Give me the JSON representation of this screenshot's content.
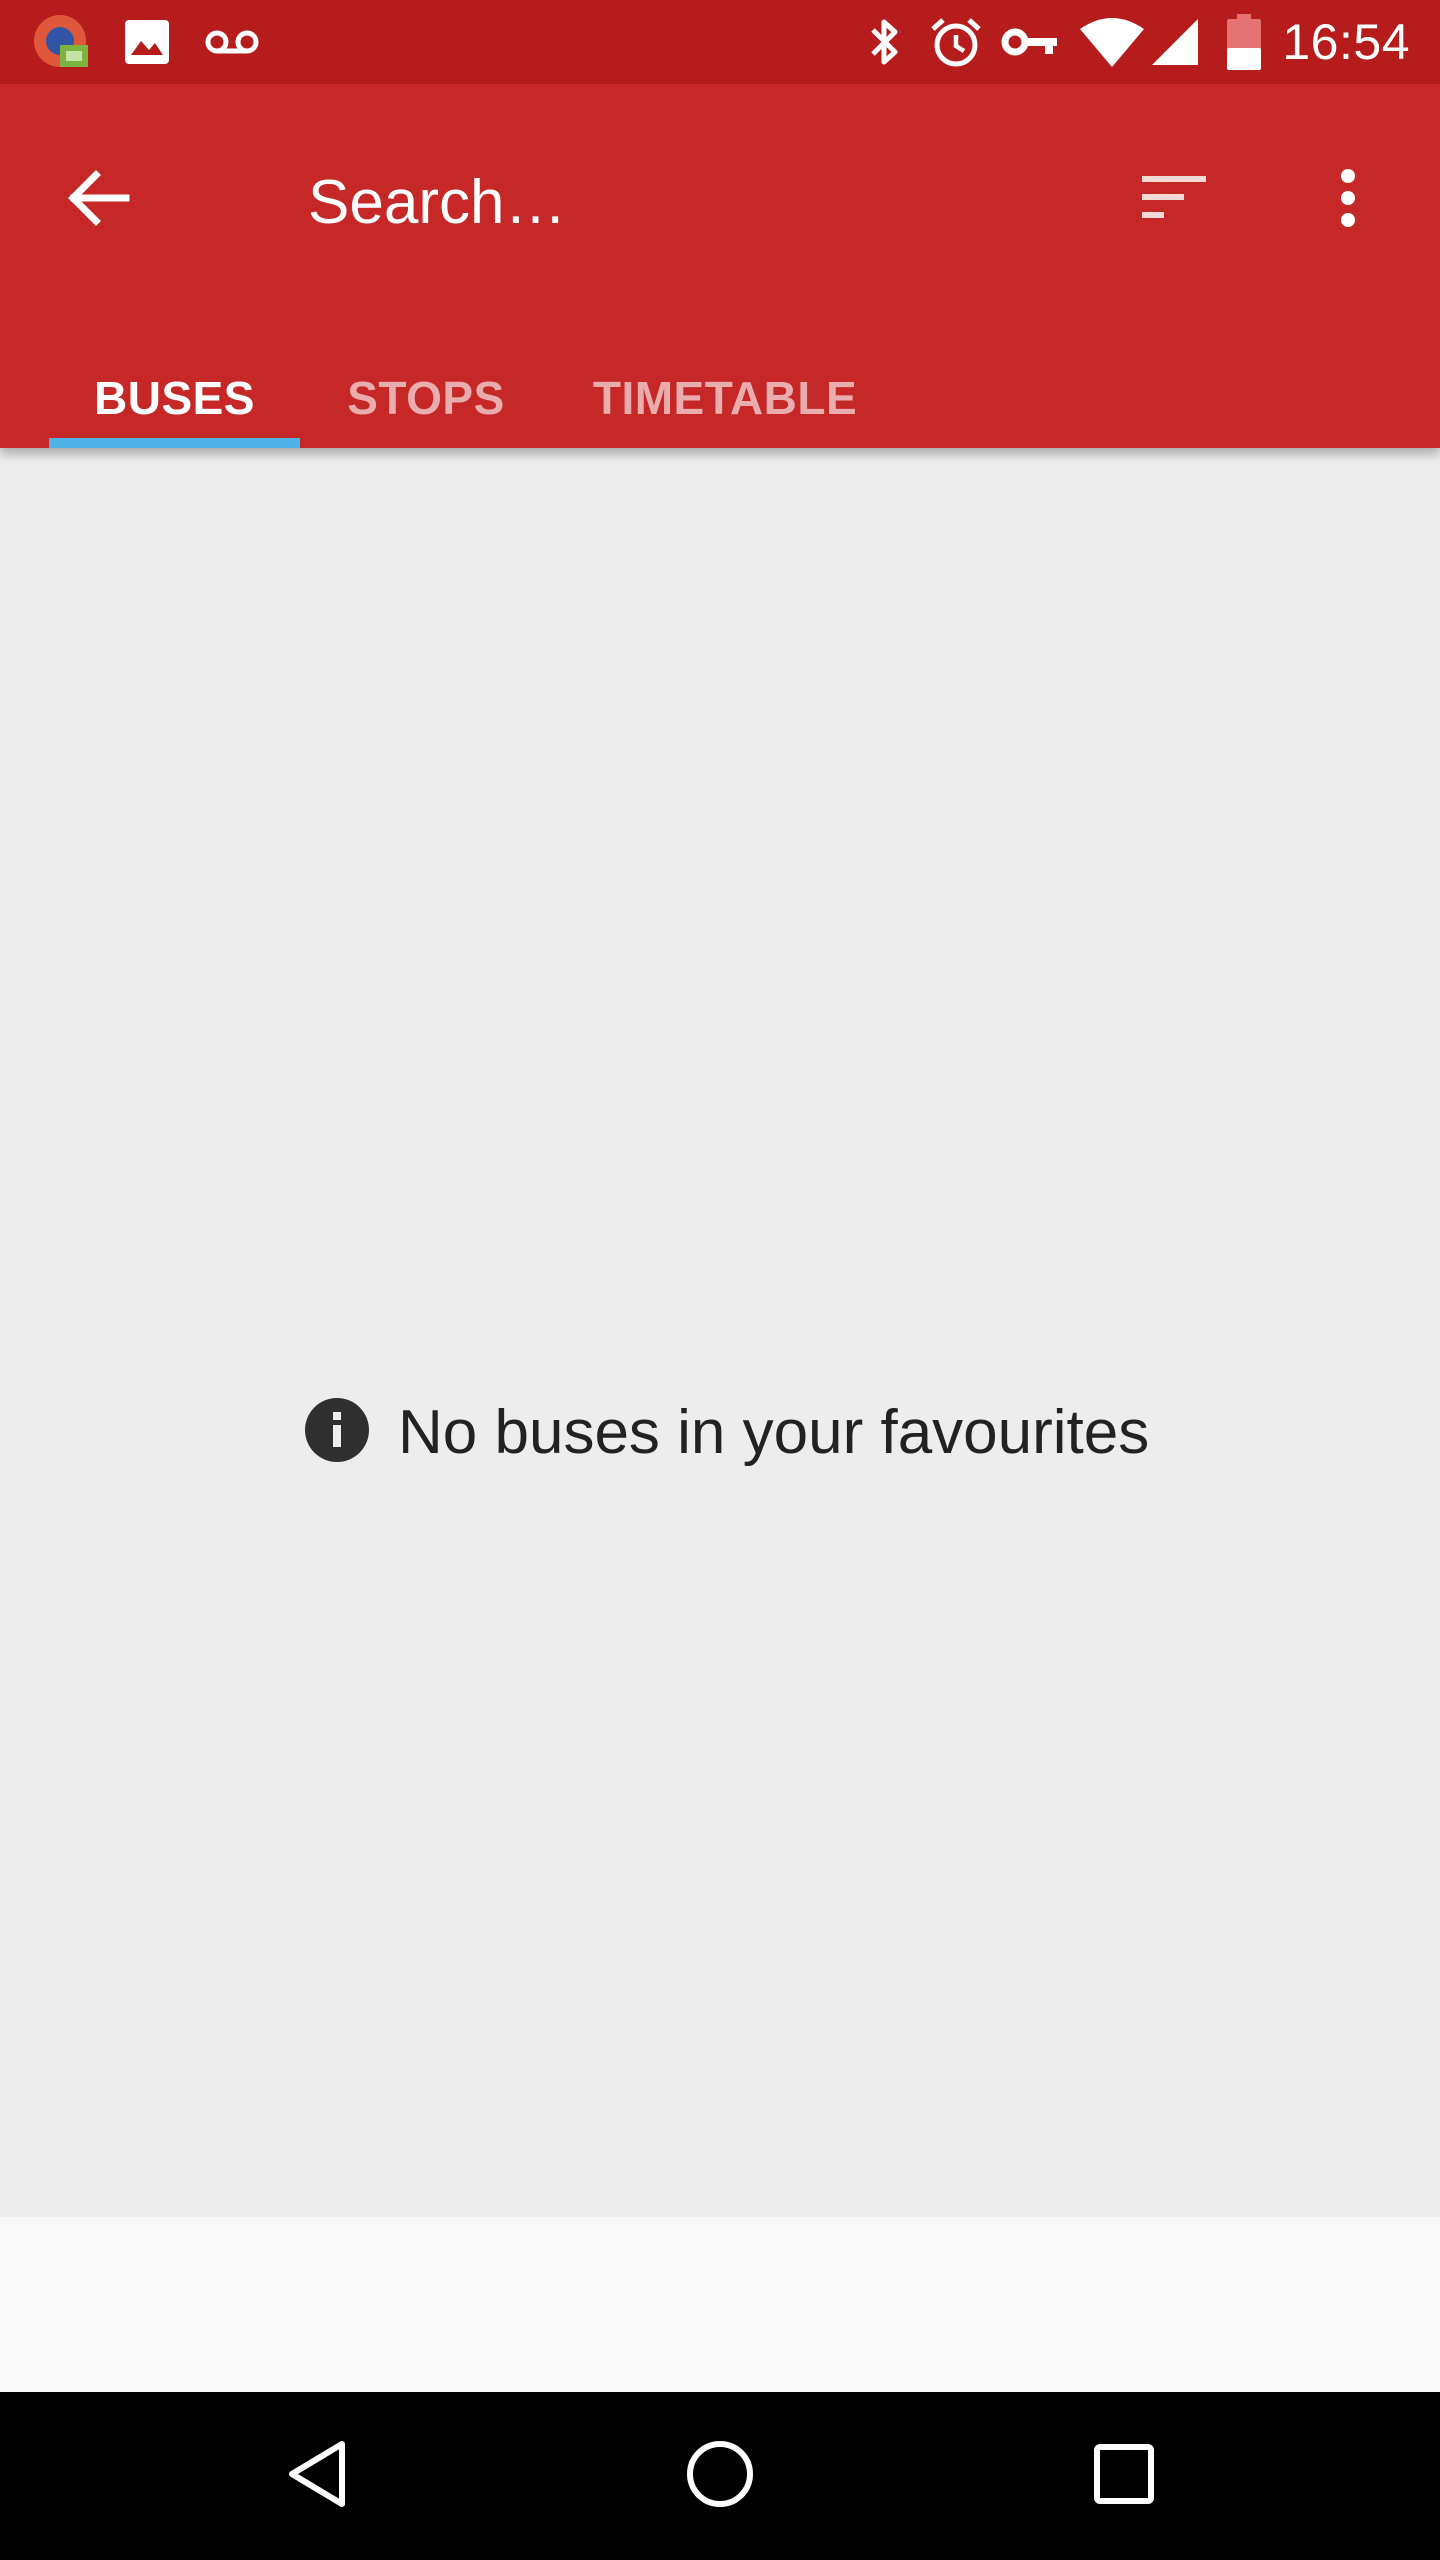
{
  "status_bar": {
    "time": "16:54",
    "left_icons": [
      "app-notification-icon",
      "image-icon",
      "voicemail-icon"
    ],
    "right_icons": [
      "bluetooth-icon",
      "alarm-icon",
      "vpn-key-icon",
      "wifi-icon",
      "signal-icon",
      "battery-icon"
    ]
  },
  "toolbar": {
    "search_placeholder": "Search…",
    "back_icon": "arrow-back-icon",
    "sort_icon": "sort-icon",
    "more_icon": "more-vert-icon"
  },
  "tabs": [
    {
      "label": "BUSES",
      "active": true
    },
    {
      "label": "STOPS",
      "active": false
    },
    {
      "label": "TIMETABLE",
      "active": false
    }
  ],
  "content": {
    "empty_message": "No buses in your favourites",
    "info_icon": "info-icon"
  },
  "navigation": {
    "back_icon": "nav-back-icon",
    "home_icon": "nav-home-icon",
    "recents_icon": "nav-recents-icon"
  },
  "colors": {
    "status_bar": "#b71c1c",
    "app_bar": "#c62828",
    "tab_indicator": "#4fb3e8",
    "content_bg": "#ededed",
    "nav_bar": "#000000"
  }
}
